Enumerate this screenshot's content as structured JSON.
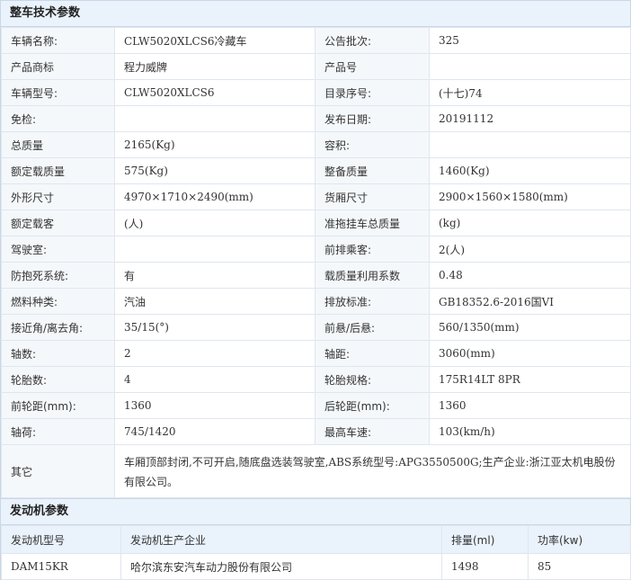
{
  "vehicle_section": {
    "title": "整车技术参数",
    "rows": [
      {
        "l1": "车辆名称:",
        "v1": "CLW5020XLCS6冷藏车",
        "l2": "公告批次:",
        "v2": "325"
      },
      {
        "l1": "产品商标",
        "v1": "程力威牌",
        "l2": "产品号",
        "v2": ""
      },
      {
        "l1": "车辆型号:",
        "v1": "CLW5020XLCS6",
        "l2": "目录序号:",
        "v2": "(十七)74"
      },
      {
        "l1": "免检:",
        "v1": "",
        "l2": "发布日期:",
        "v2": "20191112"
      },
      {
        "l1": "总质量",
        "v1": "2165(Kg)",
        "l2": "容积:",
        "v2": ""
      },
      {
        "l1": "额定载质量",
        "v1": "575(Kg)",
        "l2": "整备质量",
        "v2": "1460(Kg)"
      },
      {
        "l1": "外形尺寸",
        "v1": "4970×1710×2490(mm)",
        "l2": "货厢尺寸",
        "v2": "2900×1560×1580(mm)"
      },
      {
        "l1": "额定载客",
        "v1": "(人)",
        "l2": "准拖挂车总质量",
        "v2": "(kg)"
      },
      {
        "l1": "驾驶室:",
        "v1": "",
        "l2": "前排乘客:",
        "v2": "2(人)"
      },
      {
        "l1": "防抱死系统:",
        "v1": "有",
        "l2": "载质量利用系数",
        "v2": "0.48"
      },
      {
        "l1": "燃料种类:",
        "v1": "汽油",
        "l2": "排放标准:",
        "v2": "GB18352.6-2016国VI"
      },
      {
        "l1": "接近角/离去角:",
        "v1": "35/15(°)",
        "l2": "前悬/后悬:",
        "v2": "560/1350(mm)"
      },
      {
        "l1": "轴数:",
        "v1": "2",
        "l2": "轴距:",
        "v2": "3060(mm)"
      },
      {
        "l1": "轮胎数:",
        "v1": "4",
        "l2": "轮胎规格:",
        "v2": "175R14LT 8PR"
      },
      {
        "l1": "前轮距(mm):",
        "v1": "1360",
        "l2": "后轮距(mm):",
        "v2": "1360"
      },
      {
        "l1": "轴荷:",
        "v1": "745/1420",
        "l2": "最高车速:",
        "v2": "103(km/h)"
      }
    ],
    "other_label": "其它",
    "other_value": "车厢顶部封闭,不可开启,随底盘选装驾驶室,ABS系统型号:APG3550500G;生产企业:浙江亚太机电股份有限公司。"
  },
  "engine_section": {
    "title": "发动机参数",
    "headers": [
      "发动机型号",
      "发动机生产企业",
      "排量(ml)",
      "功率(kw)"
    ],
    "rows": [
      [
        "DAM15KR",
        "哈尔滨东安汽车动力股份有限公司",
        "1498",
        "85"
      ]
    ]
  }
}
